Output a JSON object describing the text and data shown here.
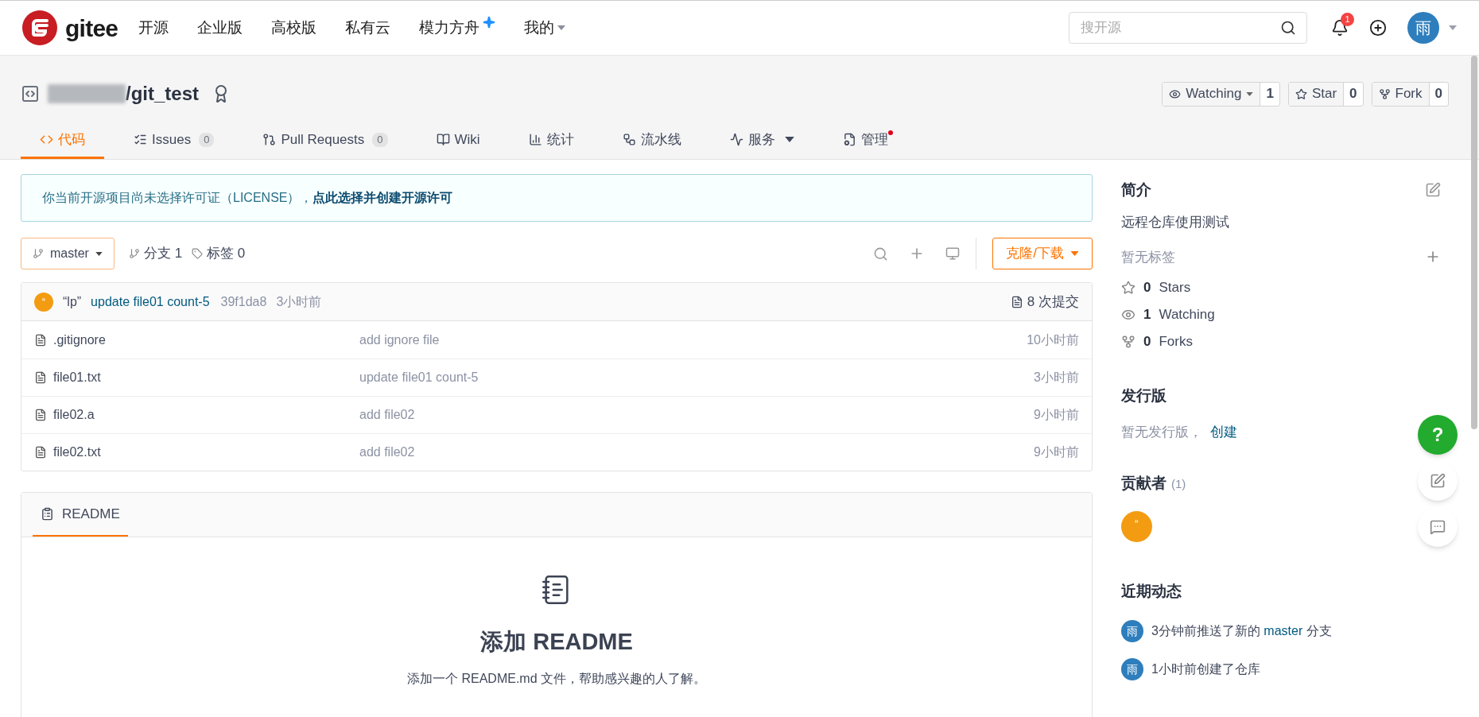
{
  "header": {
    "logo_text": "gitee",
    "nav": [
      {
        "label": "开源",
        "kind": "plain"
      },
      {
        "label": "企业版",
        "kind": "plain"
      },
      {
        "label": "高校版",
        "kind": "plain"
      },
      {
        "label": "私有云",
        "kind": "plain"
      },
      {
        "label": "模力方舟",
        "kind": "sparkle"
      },
      {
        "label": "我的",
        "kind": "dropdown"
      }
    ],
    "search": {
      "placeholder": "搜开源"
    },
    "notification_count": "1",
    "avatar": "雨"
  },
  "repo": {
    "name": "/git_test",
    "actions": [
      {
        "label": "Watching",
        "count": "1",
        "kind": "watch"
      },
      {
        "label": "Star",
        "count": "0",
        "kind": "star"
      },
      {
        "label": "Fork",
        "count": "0",
        "kind": "fork"
      }
    ],
    "tabs": [
      {
        "label": "代码",
        "kind": "code",
        "selected": true
      },
      {
        "label": "Issues",
        "count": "0",
        "kind": "issues",
        "selected": false
      },
      {
        "label": "Pull Requests",
        "count": "0",
        "kind": "pr",
        "selected": false
      },
      {
        "label": "Wiki",
        "kind": "wiki",
        "selected": false
      },
      {
        "label": "统计",
        "kind": "stats",
        "selected": false
      },
      {
        "label": "流水线",
        "kind": "pipeline",
        "selected": false
      },
      {
        "label": "服务",
        "kind": "service",
        "selected": false
      },
      {
        "label": "管理",
        "kind": "manage",
        "selected": false,
        "dot": true
      }
    ]
  },
  "license_notice": {
    "text": "你当前开源项目尚未选择许可证（LICENSE），",
    "link": "点此选择并创建开源许可"
  },
  "toolbar": {
    "branch": "master",
    "branches": "分支 1",
    "tags": "标签 0",
    "clone": "克隆/下载"
  },
  "commit": {
    "author": "“lp”",
    "message": "update file01 count-5",
    "hash": "39f1da8",
    "time": "3小时前",
    "count": "8 次提交"
  },
  "files": [
    {
      "name": ".gitignore",
      "message": "add ignore file",
      "time": "10小时前"
    },
    {
      "name": "file01.txt",
      "message": "update file01 count-5",
      "time": "3小时前"
    },
    {
      "name": "file02.a",
      "message": "add file02",
      "time": "9小时前"
    },
    {
      "name": "file02.txt",
      "message": "add file02",
      "time": "9小时前"
    }
  ],
  "readme": {
    "tab": "README",
    "title": "添加 README",
    "subtitle": "添加一个 README.md 文件，帮助感兴趣的人了解。"
  },
  "sidebar": {
    "intro_title": "简介",
    "description": "远程仓库使用测试",
    "tags": "暂无标签",
    "stats": [
      {
        "count": "0",
        "label": "Stars",
        "kind": "star"
      },
      {
        "count": "1",
        "label": "Watching",
        "kind": "watch"
      },
      {
        "count": "0",
        "label": "Forks",
        "kind": "fork"
      }
    ],
    "releases_title": "发行版",
    "releases_text": "暂无发行版，",
    "releases_link": "创建",
    "contributors_title": "贡献者",
    "contributors_count": "(1)",
    "contributor_avatar": "“",
    "activity_title": "近期动态",
    "activity": [
      {
        "avatar": "雨",
        "before": "3分钟前推送了新的",
        "link": "master",
        "after": "分支"
      },
      {
        "avatar": "雨",
        "before": "1小时前创建了仓库"
      }
    ]
  },
  "float_buttons": [
    {
      "kind": "help",
      "label": "?"
    },
    {
      "kind": "edit"
    },
    {
      "kind": "chat"
    }
  ]
}
